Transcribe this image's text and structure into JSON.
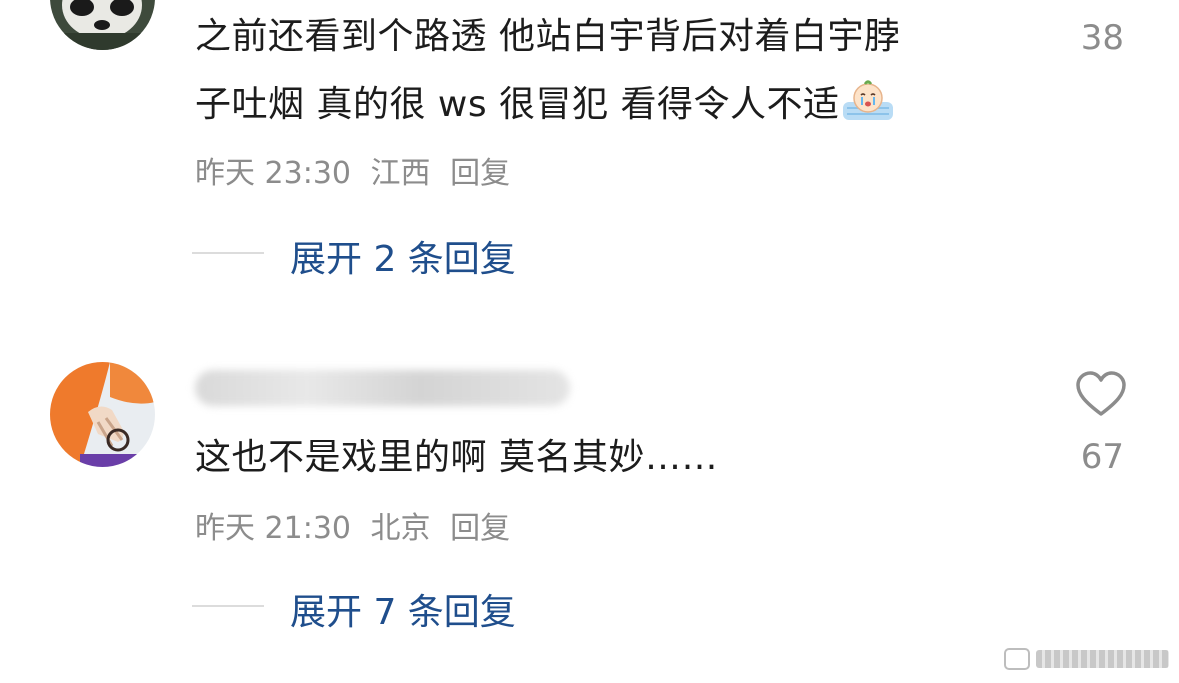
{
  "comments": [
    {
      "text_line1": "之前还看到个路透 他站白宇背后对着白宇脖",
      "text_line2": "子吐烟 真的很 ws 很冒犯 看得令人不适",
      "emoji": "crying-emoji",
      "time": "昨天 23:30",
      "location": "江西",
      "reply_label": "回复",
      "likes": "38",
      "expand_label": "展开 2 条回复"
    },
    {
      "text": "这也不是戏里的啊 莫名其妙……",
      "time": "昨天 21:30",
      "location": "北京",
      "reply_label": "回复",
      "likes": "67",
      "like_icon": "heart-icon",
      "expand_label": "展开 7 条回复"
    }
  ],
  "colors": {
    "text": "#1c1c1c",
    "meta": "#8c8c8c",
    "link": "#1f4e8c",
    "divider": "#dcdcdc"
  }
}
